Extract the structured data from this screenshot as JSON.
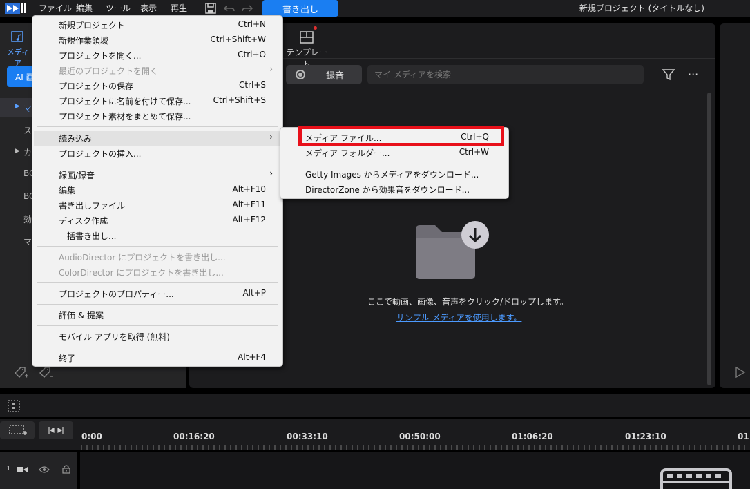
{
  "menubar": {
    "items": [
      "ファイル",
      "編集",
      "ツール",
      "表示",
      "再生"
    ],
    "export_label": "書き出し",
    "project_title": "新規プロジェクト (タイトルなし)"
  },
  "left_panel": {
    "media_tab_label": "メディア",
    "ai_label": "AI 画",
    "tree": [
      "マ",
      "ス",
      "カ",
      "BG",
      "BG",
      "効",
      "マ"
    ]
  },
  "center_panel": {
    "template_tab_label": "テンプレート",
    "record_label": "録音",
    "search_placeholder": "マイ メディアを検索",
    "more_glyph": "···",
    "drop_text": "ここで動画、画像、音声をクリック/ドロップします。",
    "sample_link": "サンプル メディアを使用します。"
  },
  "file_menu": {
    "items": [
      {
        "label": "新規プロジェクト",
        "shortcut": "Ctrl+N"
      },
      {
        "label": "新規作業領域",
        "shortcut": "Ctrl+Shift+W"
      },
      {
        "label": "プロジェクトを開く...",
        "shortcut": "Ctrl+O"
      },
      {
        "label": "最近のプロジェクトを開く",
        "shortcut": ""
      },
      {
        "label": "プロジェクトの保存",
        "shortcut": "Ctrl+S"
      },
      {
        "label": "プロジェクトに名前を付けて保存...",
        "shortcut": "Ctrl+Shift+S"
      },
      {
        "label": "プロジェクト素材をまとめて保存...",
        "shortcut": ""
      },
      {
        "label": "読み込み",
        "shortcut": ""
      },
      {
        "label": "プロジェクトの挿入...",
        "shortcut": ""
      },
      {
        "label": "録画/録音",
        "shortcut": ""
      },
      {
        "label": "編集",
        "shortcut": "Alt+F10"
      },
      {
        "label": "書き出しファイル",
        "shortcut": "Alt+F11"
      },
      {
        "label": "ディスク作成",
        "shortcut": "Alt+F12"
      },
      {
        "label": "一括書き出し...",
        "shortcut": ""
      },
      {
        "label": "AudioDirector にプロジェクトを書き出し...",
        "shortcut": ""
      },
      {
        "label": "ColorDirector にプロジェクトを書き出し...",
        "shortcut": ""
      },
      {
        "label": "プロジェクトのプロパティー...",
        "shortcut": "Alt+P"
      },
      {
        "label": "評価 & 提案",
        "shortcut": ""
      },
      {
        "label": "モバイル アプリを取得 (無料)",
        "shortcut": ""
      },
      {
        "label": "終了",
        "shortcut": "Alt+F4"
      }
    ]
  },
  "import_submenu": {
    "items": [
      {
        "label": "メディア ファイル...",
        "shortcut": "Ctrl+Q"
      },
      {
        "label": "メディア フォルダー...",
        "shortcut": "Ctrl+W"
      },
      {
        "label": "Getty Images からメディアをダウンロード...",
        "shortcut": ""
      },
      {
        "label": "DirectorZone から効果音をダウンロード...",
        "shortcut": ""
      }
    ]
  },
  "timeline": {
    "timecodes": [
      "0:00",
      "00:16:20",
      "00:33:10",
      "00:50:00",
      "01:06:20",
      "01:23:10",
      "01"
    ],
    "track_number": "1"
  },
  "colors": {
    "accent": "#1a7ef2",
    "highlight_box": "#e8101a",
    "link": "#4c9aff"
  }
}
